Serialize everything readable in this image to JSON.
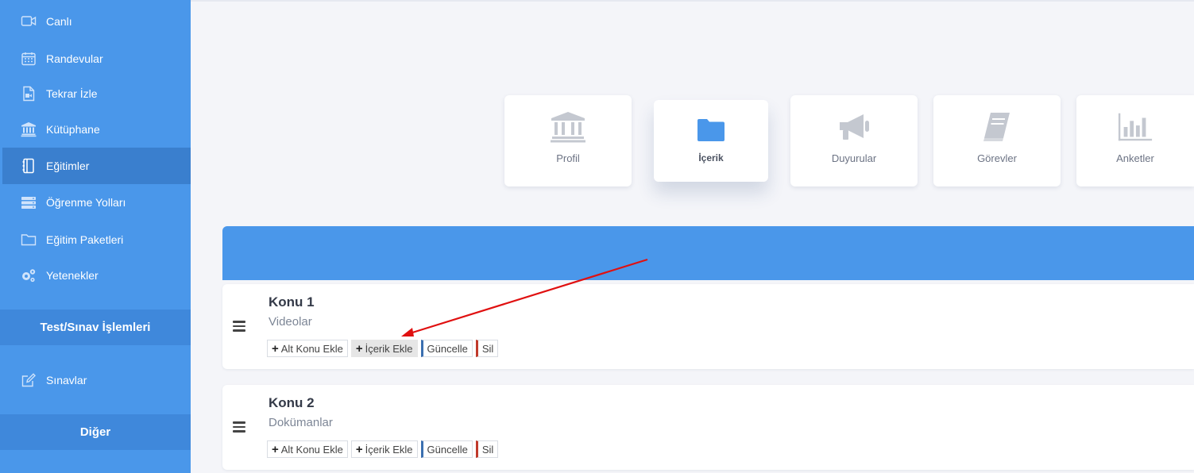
{
  "sidebar": {
    "items": [
      {
        "label": "Canlı",
        "icon": "video-camera-icon"
      },
      {
        "label": "Randevular",
        "icon": "calendar-icon"
      },
      {
        "label": "Tekrar İzle",
        "icon": "file-video-icon"
      },
      {
        "label": "Kütüphane",
        "icon": "library-icon"
      },
      {
        "label": "Eğitimler",
        "icon": "notebook-icon",
        "active": true
      },
      {
        "label": "Öğrenme Yolları",
        "icon": "server-icon"
      },
      {
        "label": "Eğitim Paketleri",
        "icon": "folder-icon"
      },
      {
        "label": "Yetenekler",
        "icon": "gears-icon"
      }
    ],
    "section_test": "Test/Sınav İşlemleri",
    "test_items": [
      {
        "label": "Sınavlar",
        "icon": "edit-icon"
      }
    ],
    "section_other": "Diğer"
  },
  "cards": [
    {
      "label": "Profil",
      "icon": "library-icon"
    },
    {
      "label": "İçerik",
      "icon": "folder-icon",
      "active": true
    },
    {
      "label": "Duyurular",
      "icon": "megaphone-icon"
    },
    {
      "label": "Görevler",
      "icon": "book-icon"
    },
    {
      "label": "Anketler",
      "icon": "bar-chart-icon"
    }
  ],
  "topics": [
    {
      "title": "Konu 1",
      "subtitle": "Videolar",
      "buttons": {
        "add_subtopic": "Alt Konu Ekle",
        "add_content": "İçerik Ekle",
        "update": "Güncelle",
        "delete": "Sil"
      }
    },
    {
      "title": "Konu 2",
      "subtitle": "Dokümanlar",
      "buttons": {
        "add_subtopic": "Alt Konu Ekle",
        "add_content": "İçerik Ekle",
        "update": "Güncelle",
        "delete": "Sil"
      }
    }
  ],
  "colors": {
    "sidebar": "#4a97ea",
    "sidebar_active": "#3a7fce",
    "accent": "#4a97ea",
    "annotation_arrow": "#e01010",
    "update_border": "#3b6fb0",
    "delete_border": "#c0392b"
  }
}
